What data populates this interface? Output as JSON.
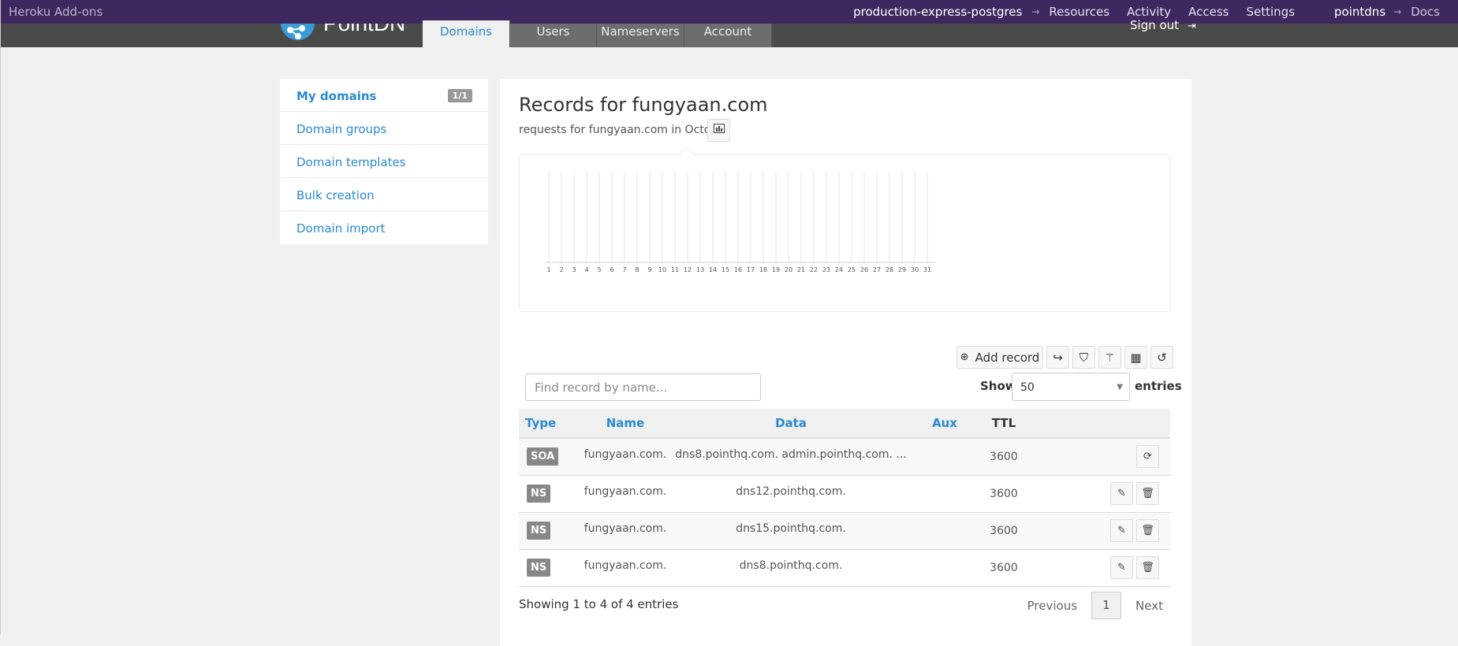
{
  "heroku": {
    "brand": "Heroku Add-ons",
    "app_name": "production-express-postgres",
    "arrow": "→",
    "links": [
      "Resources",
      "Activity",
      "Access",
      "Settings"
    ],
    "user": "pointdns",
    "docs": "Docs"
  },
  "appnav": {
    "logo_text": "PointDNS",
    "tabs": [
      "Domains",
      "Users",
      "Nameservers",
      "Account"
    ],
    "active_tab": "Domains",
    "sign_out": "Sign out"
  },
  "sidebar": {
    "items": [
      {
        "label": "My domains",
        "badge": "1/1"
      },
      {
        "label": "Domain groups"
      },
      {
        "label": "Domain templates"
      },
      {
        "label": "Bulk creation"
      },
      {
        "label": "Domain import"
      }
    ]
  },
  "main": {
    "title": "Records for fungyaan.com",
    "subtitle": "requests for fungyaan.com in October",
    "add_record_label": "Add record",
    "search_placeholder": "Find record by name...",
    "show_label": "Show",
    "page_size": "50",
    "entries_label": "entries",
    "showing_text": "Showing 1 to 4 of 4 entries",
    "pager": {
      "previous": "Previous",
      "current": "1",
      "next": "Next"
    }
  },
  "table": {
    "columns": [
      "Type",
      "Name",
      "Data",
      "Aux",
      "TTL"
    ],
    "rows": [
      {
        "type": "SOA",
        "name": "fungyaan.com.",
        "data": "dns8.pointhq.com. admin.pointhq.com. ...",
        "aux": "",
        "ttl": "3600"
      },
      {
        "type": "NS",
        "name": "fungyaan.com.",
        "data": "dns12.pointhq.com.",
        "aux": "",
        "ttl": "3600"
      },
      {
        "type": "NS",
        "name": "fungyaan.com.",
        "data": "dns15.pointhq.com.",
        "aux": "",
        "ttl": "3600"
      },
      {
        "type": "NS",
        "name": "fungyaan.com.",
        "data": "dns8.pointhq.com.",
        "aux": "",
        "ttl": "3600"
      }
    ]
  },
  "chart_data": {
    "type": "bar",
    "categories": [
      "1",
      "2",
      "3",
      "4",
      "5",
      "6",
      "7",
      "8",
      "9",
      "10",
      "11",
      "12",
      "13",
      "14",
      "15",
      "16",
      "17",
      "18",
      "19",
      "20",
      "21",
      "22",
      "23",
      "24",
      "25",
      "26",
      "27",
      "28",
      "29",
      "30",
      "31"
    ],
    "values": [
      0,
      0,
      0,
      0,
      0,
      0,
      0,
      0,
      0,
      0,
      0,
      0,
      0,
      0,
      0,
      0,
      0,
      0,
      0,
      0,
      0,
      0,
      0,
      0,
      0,
      0,
      0,
      0,
      0,
      0,
      0
    ],
    "title": "",
    "grid": true
  },
  "colors": {
    "heroku_bar": "#3e2860",
    "link_blue": "#2a8ad0",
    "type_badge": "#888888"
  }
}
